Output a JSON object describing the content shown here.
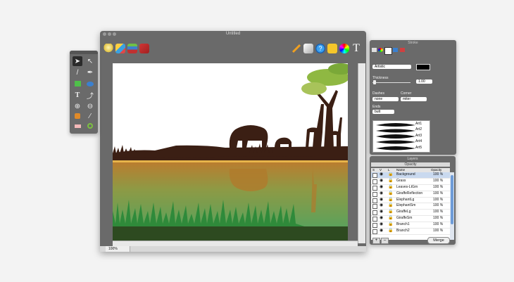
{
  "window": {
    "title": "Untitled",
    "zoom": "100%"
  },
  "stroke_panel": {
    "title": "Stroke",
    "brush": "Artistic",
    "thickness_label": "Thickness",
    "thickness_value": "1.00",
    "dashes_label": "Dashes",
    "dashes_value": "none",
    "corner_label": "Corner",
    "corner_value": "miter",
    "ends_label": "Ends",
    "ends_value": "butt",
    "stroke_color": "#000000",
    "art_items": [
      "Art1",
      "Art2",
      "Art3",
      "Art4",
      "Art5"
    ]
  },
  "layers_panel": {
    "title": "Layers",
    "opacity_label": "Opacity",
    "col_s": "S",
    "col_v": "V",
    "col_l": "L",
    "col_name": "Name",
    "col_opacity": "Opacity",
    "rows": [
      {
        "name": "Background",
        "opacity": "100 %"
      },
      {
        "name": "Grass",
        "opacity": "100 %"
      },
      {
        "name": "Leaves-LtGrn",
        "opacity": "100 %"
      },
      {
        "name": "GiraffeReflection",
        "opacity": "100 %"
      },
      {
        "name": "ElephantLg",
        "opacity": "100 %"
      },
      {
        "name": "ElephantSm",
        "opacity": "100 %"
      },
      {
        "name": "GiraffeLg",
        "opacity": "100 %"
      },
      {
        "name": "GiraffeSm",
        "opacity": "100 %"
      },
      {
        "name": "Branch1",
        "opacity": "100 %"
      },
      {
        "name": "Branch2",
        "opacity": "100 %"
      }
    ],
    "add_label": "+",
    "remove_label": "–",
    "merge_label": "Merge"
  },
  "colors": {
    "panel_bg": "#6a6a6a",
    "grass_green": "#5fae6a",
    "silhouette": "#3b1f14",
    "reflection": "#b07a2c"
  },
  "icons": {
    "top_toolbar": [
      "lightbulb-icon",
      "puzzle-icon",
      "stack-icon",
      "cursor-icon",
      "pencil-icon",
      "eraser-icon",
      "help-icon",
      "image-icon",
      "color-wheel-icon",
      "text-icon"
    ],
    "tools": [
      "arrow-icon",
      "direct-select-icon",
      "brush-icon",
      "pen-icon",
      "rectangle-icon",
      "ellipse-icon",
      "text-tool-icon",
      "eyedropper-icon",
      "add-icon",
      "remove-icon",
      "paint-bucket-icon",
      "knife-icon",
      "eraser-tool-icon",
      "zoom-icon"
    ]
  }
}
